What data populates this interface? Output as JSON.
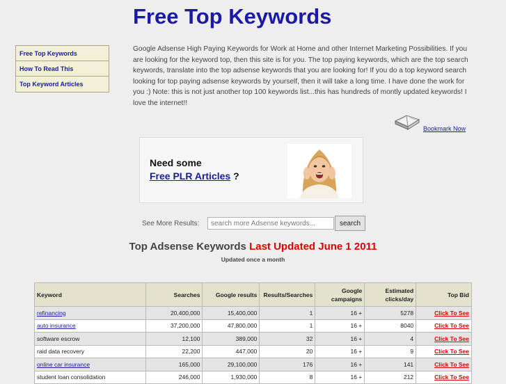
{
  "header": {
    "title": "Free Top Keywords"
  },
  "sidebar": {
    "items": [
      {
        "label": "Free Top Keywords"
      },
      {
        "label": "How To Read This"
      },
      {
        "label": "Top Keyword Articles"
      }
    ]
  },
  "intro": {
    "text": "Google Adsense High Paying Keywords for Work at Home and other Internet Marketing Possibilities. If you are looking for the keyword top, then this site is for you. The top paying keywords, which are the top search keywords, translate into the top adsense keywords that you are looking for! If you do a top keyword search looking for top paying adsense keywords by yourself, then it will take a long time. I have done the work for you :) Note: this is not just another top 100 keywords list...this has hundreds of montly updated keywords! I love the internet!!"
  },
  "bookmark": {
    "label": "Bookmark Now",
    "icon": "open-book-icon"
  },
  "promo": {
    "line1": "Need some",
    "link": "Free PLR Articles",
    "suffix": " ?",
    "image": "excited-woman-photo"
  },
  "search": {
    "label": "See More Results:",
    "placeholder": "search more Adsense keywords...",
    "button": "search"
  },
  "section": {
    "title": "Top Adsense Keywords",
    "updated": "Last Updated June 1 2011",
    "subtitle": "Updated once a month"
  },
  "table": {
    "headers": {
      "keyword": "Keyword",
      "searches": "Searches",
      "google_results": "Google results",
      "results_searches": "Results/Searches",
      "google_campaigns": "Google campaigns",
      "estimated_clicks": "Estimated clicks/day",
      "top_bid": "Top Bid"
    },
    "rows": [
      {
        "keyword": "refinancing",
        "linked": true,
        "searches": "20,400,000",
        "google_results": "15,400,000",
        "ratio": "1",
        "campaigns": "16 +",
        "clicks": "5278",
        "bid": "Click To See"
      },
      {
        "keyword": "auto insurance",
        "linked": true,
        "searches": "37,200,000",
        "google_results": "47,800,000",
        "ratio": "1",
        "campaigns": "16 +",
        "clicks": "8040",
        "bid": "Click To See"
      },
      {
        "keyword": "software escrow",
        "linked": false,
        "searches": "12,100",
        "google_results": "389,000",
        "ratio": "32",
        "campaigns": "16 +",
        "clicks": "4",
        "bid": "Click To See"
      },
      {
        "keyword": "raid data recovery",
        "linked": false,
        "searches": "22,200",
        "google_results": "447,000",
        "ratio": "20",
        "campaigns": "16 +",
        "clicks": "9",
        "bid": "Click To See"
      },
      {
        "keyword": "online car insurance",
        "linked": true,
        "searches": "165,000",
        "google_results": "29,100,000",
        "ratio": "176",
        "campaigns": "16 +",
        "clicks": "141",
        "bid": "Click To See"
      },
      {
        "keyword": "student loan consolidation",
        "linked": false,
        "searches": "246,000",
        "google_results": "1,930,000",
        "ratio": "8",
        "campaigns": "16 +",
        "clicks": "212",
        "bid": "Click To See"
      }
    ]
  },
  "colors": {
    "title_blue": "#1a1aa6",
    "updated_red": "#e00000",
    "sidebar_bg": "#f2f1d8",
    "table_header_bg": "#e3e2cd"
  }
}
